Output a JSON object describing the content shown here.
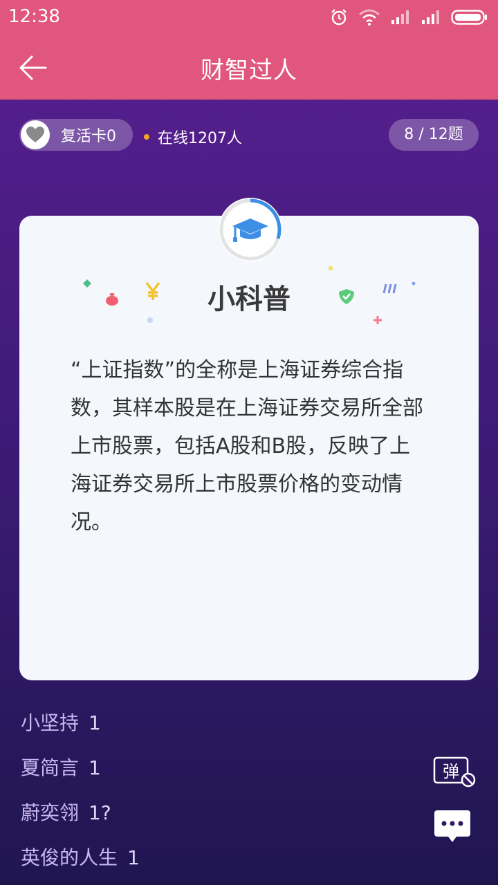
{
  "status_bar": {
    "time": "12:38",
    "icons": [
      "alarm-icon",
      "wifi-icon",
      "signal-icon",
      "signal-icon",
      "battery-icon"
    ]
  },
  "header": {
    "title": "财智过人",
    "back_icon": "arrow-left-icon"
  },
  "info": {
    "revive_label": "复活卡0",
    "online_label": "在线1207人",
    "progress_label": "8 / 12题"
  },
  "card": {
    "title": "小科普",
    "icon": "graduation-cap-icon",
    "timer_progress": 0.3,
    "text": "“上证指数”的全称是上海证券综合指数，其样本股是在上海证券交易所全部上市股票，包括A股和B股，反映了上海证券交易所上市股票价格的变动情况。"
  },
  "comments": [
    {
      "name": "小坚持",
      "text": "1"
    },
    {
      "name": "夏简言",
      "text": "1"
    },
    {
      "name": "蔚奕翎",
      "text": "1?"
    },
    {
      "name": "英俊的人生",
      "text": "1"
    }
  ],
  "actions": {
    "danmaku_label": "弹"
  },
  "colors": {
    "header_pink": "#e0567c",
    "bg_purple": "#5a1f93",
    "accent_blue": "#3d8fe6"
  }
}
